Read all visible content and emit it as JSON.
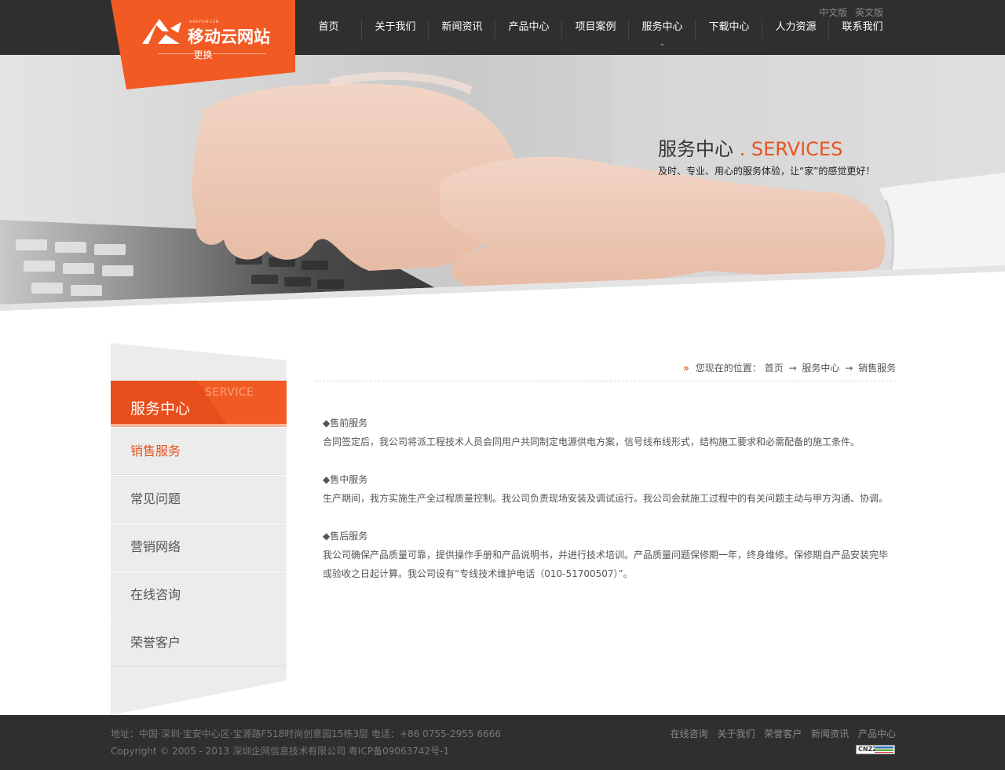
{
  "header": {
    "logo_small": "XINXUYUN.COM",
    "logo_title": "移动云网站",
    "logo_change": "更换",
    "languages": [
      "中文版",
      "英文版"
    ],
    "nav": [
      {
        "label": "首页"
      },
      {
        "label": "关于我们"
      },
      {
        "label": "新闻资讯"
      },
      {
        "label": "产品中心"
      },
      {
        "label": "项目案例"
      },
      {
        "label": "服务中心",
        "active": true
      },
      {
        "label": "下载中心"
      },
      {
        "label": "人力资源"
      },
      {
        "label": "联系我们"
      }
    ],
    "nav_caret": "⌄"
  },
  "banner": {
    "title_cn": "服务中心",
    "title_en": ". SERVICES",
    "subtitle": "及时、专业、用心的服务体验，让“家”的感觉更好！"
  },
  "sidebar": {
    "title_cn": "服务中心",
    "title_en": "SERVICE",
    "items": [
      {
        "label": "销售服务",
        "active": true
      },
      {
        "label": "常见问题"
      },
      {
        "label": "营销网络"
      },
      {
        "label": "在线咨询"
      },
      {
        "label": "荣誉客户"
      }
    ]
  },
  "breadcrumb": {
    "prefix": "您现在的位置：",
    "items": [
      "首页",
      "服务中心",
      "销售服务"
    ],
    "separator": "→"
  },
  "content": {
    "sections": [
      {
        "heading": "◆售前服务",
        "text": "合同签定后，我公司将派工程技术人员会同用户共同制定电源供电方案，信号线布线形式，结构施工要求和必需配备的施工条件。"
      },
      {
        "heading": "◆售中服务",
        "text": "生产期间，我方实施生产全过程质量控制。我公司负责现场安装及调试运行。我公司会就施工过程中的有关问题主动与甲方沟通、协调。"
      },
      {
        "heading": "◆售后服务",
        "text": "我公司确保产品质量可靠，提供操作手册和产品说明书，并进行技术培训。产品质量问题保修期一年，终身维修。保修期自产品安装完毕或验收之日起计算。我公司设有“专线技术维护电话（010-51700507）”。"
      }
    ]
  },
  "footer": {
    "address": "地址：中国·深圳·宝安中心区·宝源路F518时尚创意园15栋3层 电话：+86 0755-2955 6666",
    "copyright": "Copyright © 2005 - 2013 深圳企网信息技术有限公司 粤ICP备09063742号-1",
    "links": [
      "在线咨询",
      "关于我们",
      "荣誉客户",
      "新闻资讯",
      "产品中心"
    ],
    "badge": "CNZZ"
  },
  "colors": {
    "accent": "#f25a24",
    "dark": "#2f2f2f"
  }
}
